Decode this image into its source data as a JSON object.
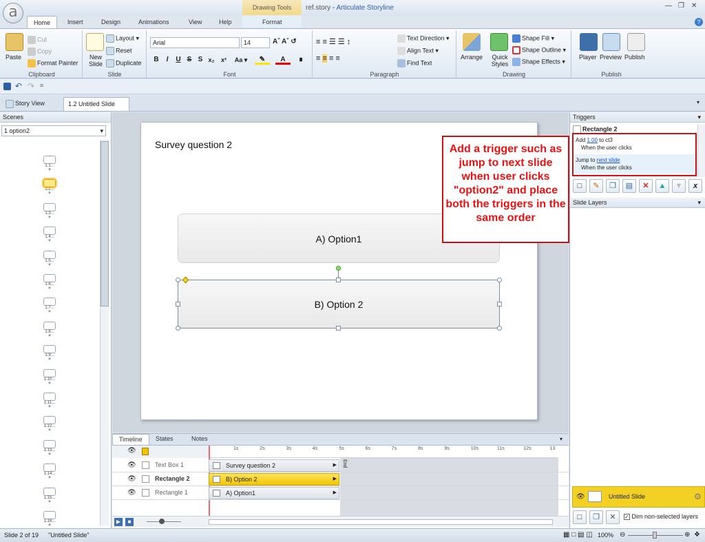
{
  "app": {
    "file": "ref.story",
    "name": "Articulate Storyline",
    "logo": "a"
  },
  "context_tab": {
    "group": "Drawing Tools",
    "tab": "Format"
  },
  "tabs": [
    "Home",
    "Insert",
    "Design",
    "Animations",
    "View",
    "Help"
  ],
  "ribbon": {
    "clipboard": {
      "label": "Clipboard",
      "paste": "Paste",
      "cut": "Cut",
      "copy": "Copy",
      "format_painter": "Format Painter"
    },
    "slide": {
      "label": "Slide",
      "new_slide": "New Slide",
      "layout": "Layout",
      "reset": "Reset",
      "duplicate": "Duplicate"
    },
    "font": {
      "label": "Font",
      "family": "Arial",
      "size": "14"
    },
    "paragraph": {
      "label": "Paragraph",
      "text_direction": "Text Direction",
      "align_text": "Align Text",
      "find_text": "Find Text"
    },
    "drawing": {
      "label": "Drawing",
      "arrange": "Arrange",
      "quick_styles": "Quick Styles",
      "shape_fill": "Shape Fill",
      "shape_outline": "Shape Outline",
      "shape_effects": "Shape Effects"
    },
    "publish": {
      "label": "Publish",
      "player": "Player",
      "preview": "Preview",
      "publish": "Publish"
    }
  },
  "doc_tabs": {
    "story_view": "Story View",
    "slide_tab": "1.2 Untitled Slide"
  },
  "scenes": {
    "header": "Scenes",
    "selected": "1 option2",
    "slides": [
      "1.1...",
      "1.2...",
      "1.3...",
      "1.4...",
      "1.5...",
      "1.6...",
      "1.7...",
      "1.8...",
      "1.9...",
      "1.10...",
      "1.11...",
      "1.12...",
      "1.13...",
      "1.14...",
      "1.15...",
      "1.16..."
    ]
  },
  "slide": {
    "title": "Survey question 2",
    "option1": "A) Option1",
    "option2": "B) Option 2"
  },
  "callout": "Add a trigger such as jump to next slide when user clicks \"option2\" and place both the triggers in the same order",
  "triggers": {
    "header": "Triggers",
    "object": "Rectangle 2",
    "t1": {
      "pre": "Add",
      "value": "1.00",
      "post": "to ct3",
      "when": "When the user clicks"
    },
    "t2": {
      "pre": "Jump to",
      "target": "next slide",
      "when": "When the user clicks"
    }
  },
  "layers": {
    "header": "Slide Layers",
    "base": "Untitled Slide",
    "dim_label": "Dim non-selected layers"
  },
  "timeline": {
    "tabs": [
      "Timeline",
      "States",
      "Notes"
    ],
    "ticks": [
      "1s",
      "2s",
      "3s",
      "4s",
      "5s",
      "6s",
      "7s",
      "8s",
      "9s",
      "10s",
      "11s",
      "12s",
      "13"
    ],
    "end_label": "End",
    "rows": [
      {
        "name": "Text Box 1",
        "bar": "Survey question 2"
      },
      {
        "name": "Rectangle 2",
        "bar": "B) Option 2"
      },
      {
        "name": "Rectangle 1",
        "bar": "A) Option1"
      }
    ]
  },
  "status": {
    "slide": "Slide 2 of 19",
    "title": "\"Untitled Slide\"",
    "zoom": "100%"
  },
  "colors": {
    "accent_red": "#cc1111",
    "selection_yellow": "#f2d124"
  }
}
